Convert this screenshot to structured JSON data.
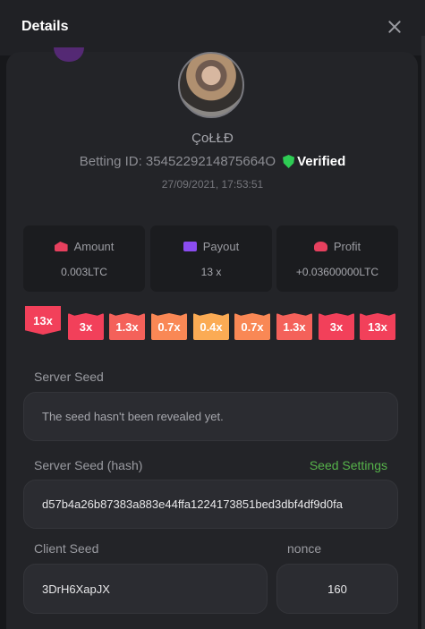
{
  "header": {
    "title": "Details"
  },
  "player": {
    "username": "ÇoŁŁĐ",
    "betting_id_label": "Betting ID: 3545229214875664O",
    "verified_label": "Verified",
    "timestamp": "27/09/2021, 17:53:51"
  },
  "stats": [
    {
      "label": "Amount",
      "value": "0.003LTC",
      "icon": "amount-icon"
    },
    {
      "label": "Payout",
      "value": "13 x",
      "icon": "wallet-icon"
    },
    {
      "label": "Profit",
      "value": "+0.03600000LTC",
      "icon": "profit-icon"
    }
  ],
  "multipliers": {
    "active": {
      "label": "13x",
      "color": "#f2405a"
    },
    "items": [
      {
        "label": "3x",
        "color": "#f2405a"
      },
      {
        "label": "1.3x",
        "color": "#f4615a"
      },
      {
        "label": "0.7x",
        "color": "#f98855"
      },
      {
        "label": "0.4x",
        "color": "#fbab54"
      },
      {
        "label": "0.7x",
        "color": "#f98855"
      },
      {
        "label": "1.3x",
        "color": "#f4615a"
      },
      {
        "label": "3x",
        "color": "#f2405a"
      },
      {
        "label": "13x",
        "color": "#f2405a"
      }
    ]
  },
  "server_seed": {
    "label": "Server Seed",
    "value": "The seed hasn't been revealed yet."
  },
  "server_seed_hash": {
    "label": "Server Seed (hash)",
    "settings_link": "Seed Settings",
    "value": "d57b4a26b87383a883e44ffa1224173851bed3dbf4df9d0fa"
  },
  "client_seed": {
    "label": "Client Seed",
    "value": "3DrH6XapJX"
  },
  "nonce": {
    "label": "nonce",
    "value": "160"
  },
  "colors": {
    "accent_green": "#56b34a",
    "verified_green": "#2ecc54",
    "brand_red": "#f2405a"
  }
}
